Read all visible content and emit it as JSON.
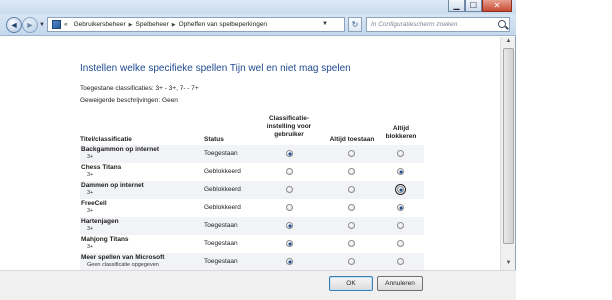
{
  "window": {
    "minimize_glyph": "▁",
    "maximize_glyph": "☐",
    "close_glyph": "✕"
  },
  "navigation": {
    "back_glyph": "◄",
    "forward_glyph": "►",
    "dropdown_glyph": "▼",
    "breadcrumb_prefix": "«",
    "breadcrumbs": [
      "Gebruikersbeheer",
      "Spelbeheer",
      "Opheffen van spelbeperkingen"
    ],
    "refresh_glyph": "↻"
  },
  "search": {
    "placeholder": "In Configuratiescherm zoeken"
  },
  "page": {
    "title": "Instellen welke specifieke spellen Tijn wel en niet mag spelen",
    "allowed_ratings": "Toegestane classificaties:  3+ - 3+, 7- - 7+",
    "blocked_descriptions": "Geweigerde beschrijvingen:  Geen"
  },
  "table": {
    "headers": {
      "title": "Titel/classificatie",
      "status": "Status",
      "class_setting": "Classificatie-instelling voor gebruiker",
      "always_allow": "Altijd toestaan",
      "always_block": "Altijd blokkeren"
    },
    "rows": [
      {
        "name": "Backgammon op internet",
        "rating": "3+",
        "status": "Toegestaan",
        "selected": "class"
      },
      {
        "name": "Chess Titans",
        "rating": "3+",
        "status": "Geblokkeerd",
        "selected": "block"
      },
      {
        "name": "Dammen op internet",
        "rating": "3+",
        "status": "Geblokkeerd",
        "selected": "block"
      },
      {
        "name": "FreeCell",
        "rating": "3+",
        "status": "Geblokkeerd",
        "selected": "block"
      },
      {
        "name": "Hartenjagen",
        "rating": "3+",
        "status": "Toegestaan",
        "selected": "class"
      },
      {
        "name": "Mahjong Titans",
        "rating": "3+",
        "status": "Toegestaan",
        "selected": "class"
      },
      {
        "name": "Meer spellen van Microsoft",
        "rating": "Geen classificatie opgegeven",
        "status": "Toegestaan",
        "selected": "class"
      }
    ]
  },
  "footer": {
    "ok_label": "OK",
    "cancel_label": "Annuleren"
  }
}
